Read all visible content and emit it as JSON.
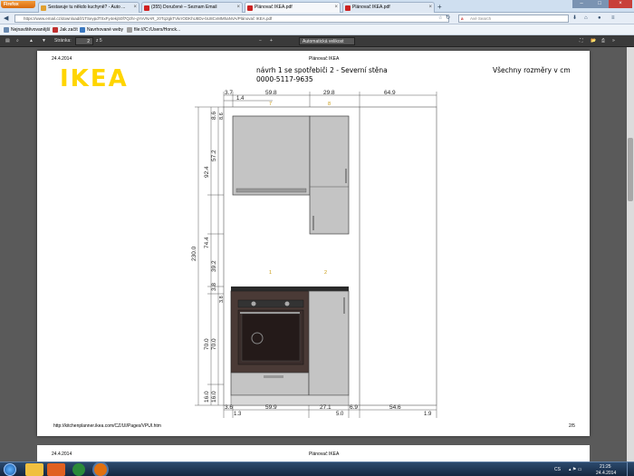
{
  "browser": {
    "menu_button": "Firefox",
    "tabs": [
      {
        "label": "Sestavuje tu někdo kuchyně? - Auto ...",
        "icon": "forum-icon",
        "color": "#e0a030"
      },
      {
        "label": "(355) Doručené – Seznam Email",
        "icon": "email-icon",
        "color": "#d02020"
      },
      {
        "label": "Plánovač IKEA.pdf",
        "icon": "pdf-icon",
        "color": "#cc2222"
      },
      {
        "label": "Plánovač IKEA.pdf",
        "icon": "pdf-icon",
        "color": "#cc2222"
      }
    ],
    "new_tab": "+",
    "url": "https://www.email.cz/download/l/1TSeypdTSxFy4ekjS0f7Qzhr-gYvVNAR_z0Tq2gkTVkrrODKhU8Dv-bU8CvMMhaNVA/Plánovač IKEA.pdf",
    "search_placeholder": "Avé Search",
    "bookmarks": [
      {
        "label": "Nejnavštěvovanější",
        "color": "#6a8ab0"
      },
      {
        "label": "Jak začít",
        "color": "#c03030"
      },
      {
        "label": "Navrhované weby",
        "color": "#3a78c0"
      },
      {
        "label": "file:///C:/Users/Honck...",
        "color": "#a0a0a0"
      }
    ]
  },
  "pdf_toolbar": {
    "page_label": "Stránka:",
    "page_number": "2",
    "page_total": "z 5",
    "zoom": "Automatická velikost",
    "zoom_minus": "−",
    "zoom_plus": "+"
  },
  "page": {
    "date": "24.4.2014",
    "header_title": "Plánovač IKEA",
    "logo": "IKEA",
    "heading_line1": "návrh 1 se spotřebiči 2 - Severní stěna",
    "heading_line2": "0000-5117-9635",
    "units_note": "Všechny rozměry v cm",
    "footer_url": "http://kitchenplanner.ikea.com/CZ/UI/Pages/VPUI.htm",
    "footer_page": "2/5"
  },
  "page2": {
    "date": "24.4.2014",
    "header_title": "Plánovač IKEA"
  },
  "drawing": {
    "top_dims": [
      "3.7",
      "59.8",
      "29.8",
      "64.9"
    ],
    "top_subdims": [
      "1.4"
    ],
    "cabinet_labels_top": [
      "7",
      "8"
    ],
    "cabinet_labels_bottom": [
      "1",
      "2"
    ],
    "left_dims_outer": [
      "230.0"
    ],
    "left_dims_mid": [
      "92.4",
      "74.4",
      "70.0",
      "16.0"
    ],
    "left_dims_inner": [
      "8.6",
      "57.2",
      "39.2",
      "3.8",
      "70.0",
      "16.0"
    ],
    "left_dims_small": [
      "8.6",
      "3.8"
    ],
    "bottom_dims": [
      "3.6",
      "59.9",
      "27.1",
      "6.9",
      "54.6"
    ],
    "bottom_subdims": [
      "1.3",
      "5.0",
      "1.9"
    ]
  },
  "taskbar": {
    "lang": "CS",
    "time": "21:25",
    "date": "24.4.2014",
    "apps": [
      {
        "name": "explorer-icon",
        "color": "#f0c040"
      },
      {
        "name": "media-player-icon",
        "color": "#e06020"
      },
      {
        "name": "chrome-icon",
        "color": "#2a8a3a"
      },
      {
        "name": "firefox-icon",
        "color": "#e07010"
      }
    ]
  }
}
